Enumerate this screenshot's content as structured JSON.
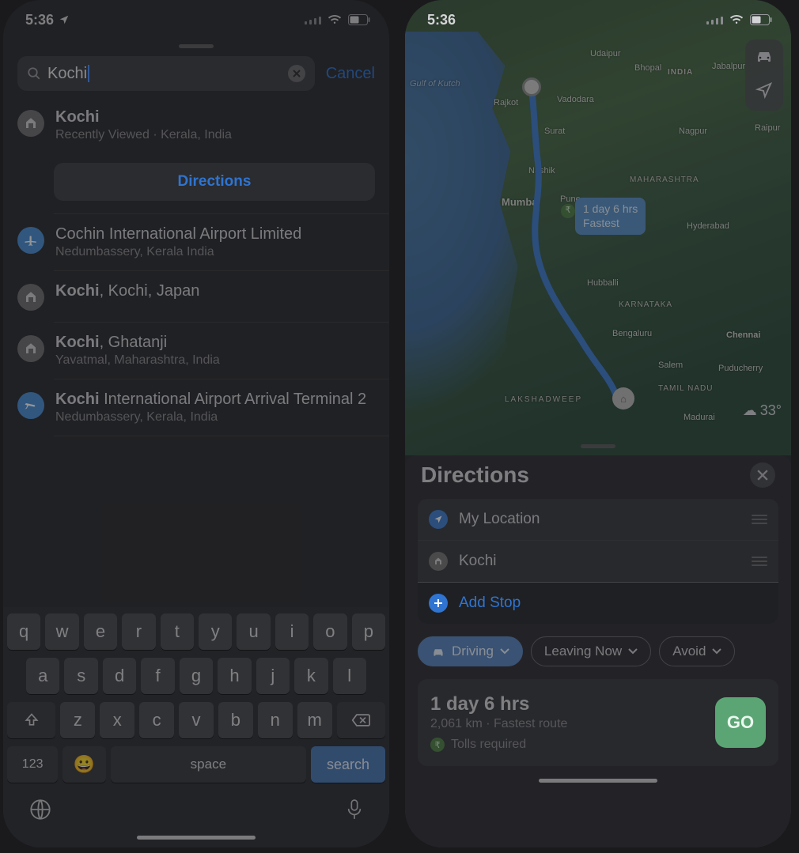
{
  "left": {
    "status": {
      "time": "5:36"
    },
    "search": {
      "value": "Kochi",
      "cancel": "Cancel"
    },
    "results": [
      {
        "title_bold": "Kochi",
        "title_rest": "",
        "subtitle": "Recently Viewed · Kerala, India",
        "icon": "place",
        "icon_color": "gray",
        "directions_btn": true
      },
      {
        "title_bold": "",
        "title_rest": "Cochin International Airport Limited",
        "subtitle": "Nedumbassery, Kerala India",
        "icon": "plane",
        "icon_color": "blue"
      },
      {
        "title_bold": "Kochi",
        "title_rest": ", Kochi, Japan",
        "subtitle": "",
        "icon": "place",
        "icon_color": "gray"
      },
      {
        "title_bold": "Kochi",
        "title_rest": ", Ghatanji",
        "subtitle": "Yavatmal, Maharashtra, India",
        "icon": "place",
        "icon_color": "gray"
      },
      {
        "title_bold": "Kochi",
        "title_rest": " International Airport Arrival Terminal 2",
        "subtitle": "Nedumbassery, Kerala, India",
        "icon": "plane-depart",
        "icon_color": "blue"
      }
    ],
    "directions_label": "Directions",
    "keyboard": {
      "row1": [
        "q",
        "w",
        "e",
        "r",
        "t",
        "y",
        "u",
        "i",
        "o",
        "p"
      ],
      "row2": [
        "a",
        "s",
        "d",
        "f",
        "g",
        "h",
        "j",
        "k",
        "l"
      ],
      "row3": [
        "z",
        "x",
        "c",
        "v",
        "b",
        "n",
        "m"
      ],
      "numbers": "123",
      "space": "space",
      "search": "search"
    }
  },
  "right": {
    "status": {
      "time": "5:36"
    },
    "map_labels": {
      "udaipur": "Udaipur",
      "bhopal": "Bhopal",
      "india": "INDIA",
      "jabalpur": "Jabalpur",
      "rajkot": "Rajkot",
      "vadodara": "Vadodara",
      "surat": "Surat",
      "nagpur": "Nagpur",
      "raipur": "Raipur",
      "nashik": "Nashik",
      "maharashtra": "MAHARASHTRA",
      "mumbai": "Mumbai",
      "pune": "Pune",
      "hyderabad": "Hyderabad",
      "hubballi": "Hubballi",
      "karnataka": "KARNATAKA",
      "bengaluru": "Bengaluru",
      "chennai": "Chennai",
      "salem": "Salem",
      "puducherry": "Puducherry",
      "tamilnadu": "TAMIL NADU",
      "lakshadweep": "LAKSHADWEEP",
      "madurai": "Madurai",
      "gulfofkutch": "Gulf of Kutch"
    },
    "route_badge": {
      "line1": "1 day 6 hrs",
      "line2": "Fastest"
    },
    "weather": "33°",
    "sheet": {
      "title": "Directions",
      "stops": [
        {
          "label": "My Location",
          "icon": "location",
          "color": "blue"
        },
        {
          "label": "Kochi",
          "icon": "place",
          "color": "gray"
        }
      ],
      "add_stop": "Add Stop",
      "pills": {
        "driving": "Driving",
        "leaving": "Leaving Now",
        "avoid": "Avoid"
      },
      "route": {
        "time": "1 day 6 hrs",
        "distance": "2,061 km · Fastest route",
        "tolls": "Tolls required",
        "go": "GO"
      }
    }
  }
}
